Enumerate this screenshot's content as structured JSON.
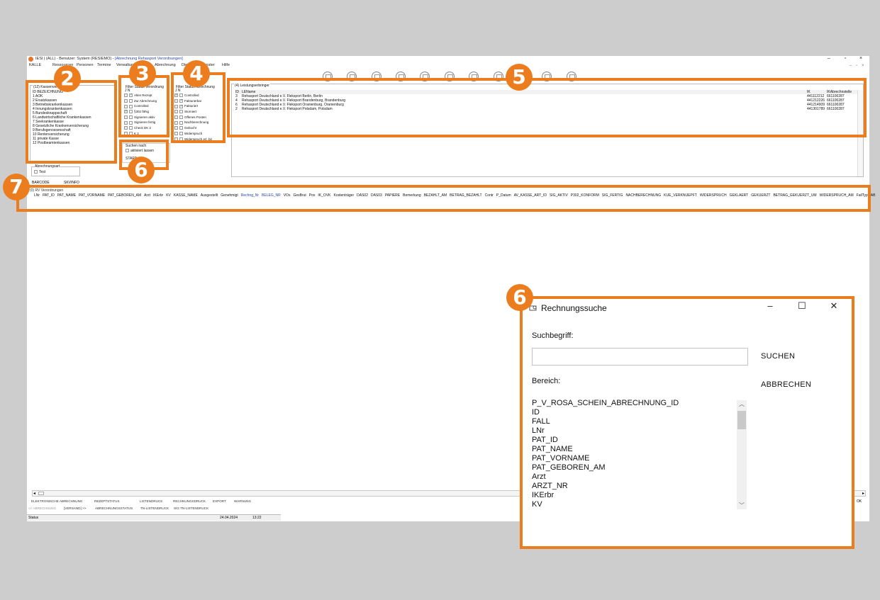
{
  "window": {
    "title_prefix": "IESI | (ALL) - Benutzer: System (RESIEMO) - ",
    "title_doc": "[Abrechnung Rehasport Verordnungen]",
    "min": "–",
    "max": "▫",
    "close": "×"
  },
  "menu": {
    "kalle": "KALLE",
    "items": [
      "Ressourcen",
      "Personen",
      "Termine",
      "Verwaltung",
      "Abrechnung",
      "Dienst",
      "Fenster",
      "Hilfe"
    ]
  },
  "panel2": {
    "title": "(12) Kassenverbände",
    "header": "ID  BEZEICHNUNG",
    "rows": [
      "1  AOK",
      "2  Ersatzkassen",
      "3  Betriebskrankenkassen",
      "4  Innungskrankenkassen",
      "5  Bundesknappschaft",
      "6  Landwirtschaftliche Krankenkassen",
      "7  Seekrankenkasse",
      "8  Gesetzliche Krankenversicherung",
      "9  Berufsgenossenschaft",
      "10  Rentenversicherung",
      "11  private Kasse",
      "12  Postbeamtenkassen"
    ]
  },
  "panel3": {
    "title": "Filter Status Verordnung",
    "jn": "J   N",
    "rows": [
      {
        "label": "Altes Rezept",
        "j": "",
        "n": "✓"
      },
      {
        "label": "Zur Abrechnung",
        "j": "",
        "n": ""
      },
      {
        "label": "Controlled",
        "j": "",
        "n": ""
      },
      {
        "label": "§302 fähig",
        "j": "✓",
        "n": ""
      },
      {
        "label": "Signieren aktiv",
        "j": "",
        "n": ""
      },
      {
        "label": "Signieren fertig",
        "j": "",
        "n": ""
      },
      {
        "label": "Check DK 2",
        "j": "",
        "n": ""
      },
      {
        "label": "K 2",
        "j": "",
        "n": ""
      }
    ]
  },
  "panel4": {
    "title": "Filter Status Abrechnung",
    "jn": "J   N",
    "rows": [
      {
        "label": "Controlled",
        "j": "✓",
        "n": ""
      },
      {
        "label": "Fakturierbar",
        "j": "",
        "n": "✓"
      },
      {
        "label": "Fakturiert",
        "j": "",
        "n": "✓"
      },
      {
        "label": "Storniert",
        "j": "",
        "n": ""
      },
      {
        "label": "Offenes Posten",
        "j": "",
        "n": ""
      },
      {
        "label": "Nachberechnung",
        "j": "",
        "n": ""
      },
      {
        "label": "Gebucht",
        "j": "",
        "n": ""
      },
      {
        "label": "Widerspruch",
        "j": "",
        "n": ""
      },
      {
        "label": "Widerspruch erl. bit",
        "j": "",
        "n": ""
      }
    ]
  },
  "panel5": {
    "title": "(4) Leistungserbringer",
    "header": {
      "id": "ID",
      "name": "LEName",
      "ik": "IK",
      "ikab": "IKAbrechnstelle"
    },
    "rows": [
      {
        "id": "3",
        "name": "Rehasport Deutschland e.V. Fleksport Berlin, Berlin",
        "ik": "441112212",
        "ikab": "661100287"
      },
      {
        "id": "4",
        "name": "Rehasport Deutschland e.V. Fleksport Brandenburg, Brandenburg",
        "ik": "441212226",
        "ikab": "661100287"
      },
      {
        "id": "6",
        "name": "Rehasport Deutschland e.V. Fleksport Oranienburg, Oranienburg",
        "ik": "441214909",
        "ikab": "661100287"
      },
      {
        "id": "2",
        "name": "Rehasport Deutschland e.V. Fleksport Potsdam, Potsdam",
        "ik": "441301789",
        "ikab": "661100287"
      }
    ]
  },
  "search_small": {
    "title": "Suchen nach",
    "aktiviert": "aktiviert lassen",
    "start": "START"
  },
  "abrechnungsart": {
    "title": "Abrechnungsart",
    "test": "Test"
  },
  "barcode": "BARCODE",
  "skvinfo": "SKVINFO",
  "verordnungen_title": "(0) RV Verordnungen",
  "columns": [
    {
      "t": "LNr",
      "c": ""
    },
    {
      "t": "PAT_ID",
      "c": ""
    },
    {
      "t": "PAT_NAME",
      "c": ""
    },
    {
      "t": "PAT_VORNAME",
      "c": ""
    },
    {
      "t": "PAT_GEBOREN_AM",
      "c": ""
    },
    {
      "t": "Arzt",
      "c": ""
    },
    {
      "t": "IKErbr",
      "c": ""
    },
    {
      "t": "KV",
      "c": ""
    },
    {
      "t": "KASSE_NAME",
      "c": ""
    },
    {
      "t": "Ausgestellt",
      "c": ""
    },
    {
      "t": "Genehmigt",
      "c": ""
    },
    {
      "t": "Rechng_Nr",
      "c": "blue"
    },
    {
      "t": "BELEG_NR",
      "c": "blue"
    },
    {
      "t": "VOs",
      "c": ""
    },
    {
      "t": "GesBrut",
      "c": ""
    },
    {
      "t": "Pos",
      "c": ""
    },
    {
      "t": "IK_OVK",
      "c": ""
    },
    {
      "t": "Kostenträger",
      "c": ""
    },
    {
      "t": "DAS02",
      "c": ""
    },
    {
      "t": "DAS03",
      "c": ""
    },
    {
      "t": "PAPIERE",
      "c": ""
    },
    {
      "t": "Bemerkung",
      "c": ""
    },
    {
      "t": "BEZAHLT_AM",
      "c": ""
    },
    {
      "t": "BETRAG_BEZAHLT",
      "c": ""
    },
    {
      "t": "Contr",
      "c": ""
    },
    {
      "t": "P_Datum",
      "c": ""
    },
    {
      "t": "AV_KASSE_ART_ID",
      "c": ""
    },
    {
      "t": "SIG_AKTIV",
      "c": ""
    },
    {
      "t": "P302_KONFORM",
      "c": ""
    },
    {
      "t": "SIG_FERTIG",
      "c": ""
    },
    {
      "t": "NACHBERECHNUNG",
      "c": ""
    },
    {
      "t": "KUE_VERKNUEPFT",
      "c": ""
    },
    {
      "t": "WIDERSPRUCH",
      "c": ""
    },
    {
      "t": "GEKLAERT",
      "c": ""
    },
    {
      "t": "GEKUERZT",
      "c": ""
    },
    {
      "t": "BETRAG_GEKUERZT_UM",
      "c": ""
    },
    {
      "t": "WIDERSPRUCH_AM",
      "c": ""
    },
    {
      "t": "FallTyp",
      "c": ""
    },
    {
      "t": "AB",
      "c": ""
    }
  ],
  "bottom_tabs1": [
    "ELEKTRONISCHE ABRECHNUNG",
    "REZEPTSTATUS",
    "LISTENDRUCK",
    "RECHNUNGSDRUCK",
    "EXPORT",
    "WARNUNG"
  ],
  "bottom_tabs2": [
    "<< ABRECHNUNG",
    "[VERSAND] >>",
    "ABRECHNUNGSSTATUS",
    "TN-LISTENDRUCK",
    "SIG TN-LISTENDRUCK"
  ],
  "ok": "OK",
  "status": {
    "label": "Status",
    "date": "24.04.2024",
    "time": "13:22"
  },
  "annotations": {
    "colour": "#ec7d1e",
    "badges": [
      "2",
      "3",
      "4",
      "5",
      "6",
      "6",
      "7"
    ]
  },
  "dialog": {
    "title": "Rechnungssuche",
    "suchbegriff": "Suchbegriff:",
    "input_value": "",
    "suchen": "SUCHEN",
    "bereich": "Bereich:",
    "abbrechen": "ABBRECHEN",
    "fields": [
      "P_V_ROSA_SCHEIN_ABRECHNUNG_ID",
      "ID",
      "FALL",
      "LNr",
      "PAT_ID",
      "PAT_NAME",
      "PAT_VORNAME",
      "PAT_GEBOREN_AM",
      "Arzt",
      "ARZT_NR",
      "IKErbr",
      "KV"
    ]
  }
}
